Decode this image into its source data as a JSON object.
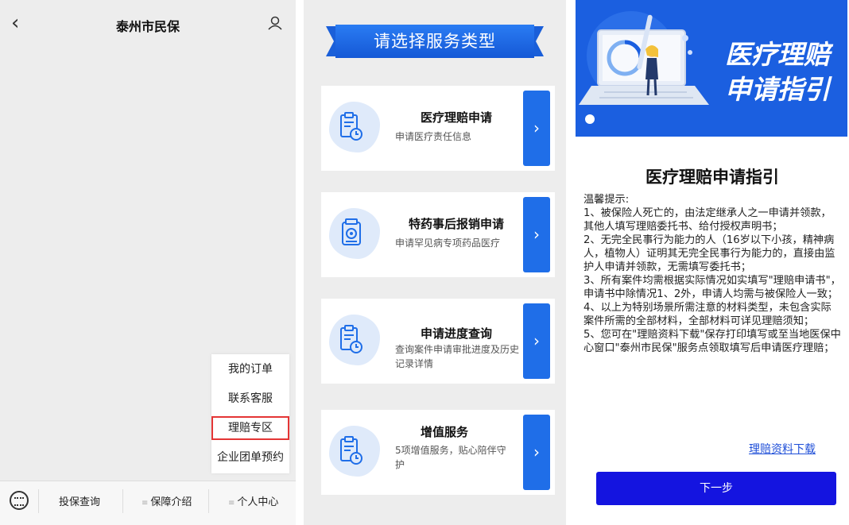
{
  "panel1": {
    "back_icon": "chevron-left-icon",
    "title": "泰州市民保",
    "user_icon": "user-icon",
    "menu": [
      "我的订单",
      "联系客服",
      "理赔专区",
      "企业团单预约"
    ],
    "highlight_color": "#e43535",
    "bottom_nav": [
      "投保查询",
      "保障介绍",
      "个人中心"
    ],
    "keyboard_icon": "keyboard-icon"
  },
  "panel2": {
    "banner": "请选择服务类型",
    "accent": "#1f6ee8",
    "cards": [
      {
        "title": "医疗理赔申请",
        "subtitle": "申请医疗责任信息",
        "icon": "clipboard-clock-icon"
      },
      {
        "title": "特药事后报销申请",
        "subtitle": "申请罕见病专项药品医疗",
        "icon": "medicine-icon"
      },
      {
        "title": "申请进度查询",
        "subtitle": "查询案件申请审批进度及历史记录详情",
        "icon": "clipboard-clock-icon"
      },
      {
        "title": "增值服务",
        "subtitle": "5项增值服务，贴心陪伴守护",
        "icon": "clipboard-clock-icon"
      }
    ]
  },
  "panel3": {
    "hero_line1": "医疗理赔",
    "hero_line2": "申请指引",
    "heading": "医疗理赔申请指引",
    "body_lines": [
      "温馨提示:",
      "1、被保险人死亡的，由法定继承人之一申请并领款，其他人填写理赔委托书、给付授权声明书；",
      "2、无完全民事行为能力的人（16岁以下小孩，精神病人，植物人）证明其无完全民事行为能力的，直接由监护人申请并领款，无需填写委托书；",
      "3、所有案件均需根据实际情况如实填写\"理赔申请书\"，申请书中除情况1、2外，申请人均需与被保险人一致；",
      "4、以上为特别场景所需注意的材料类型，未包含实际案件所需的全部材料，全部材料可详见理赔须知；",
      "5、您可在\"理赔资料下载\"保存打印填写或至当地医保中心窗口\"泰州市民保\"服务点领取填写后申请医疗理赔；"
    ],
    "download_link": "理赔资料下载",
    "next_button": "下一步",
    "hero_color": "#1b5fe0",
    "button_color": "#1414e0"
  }
}
